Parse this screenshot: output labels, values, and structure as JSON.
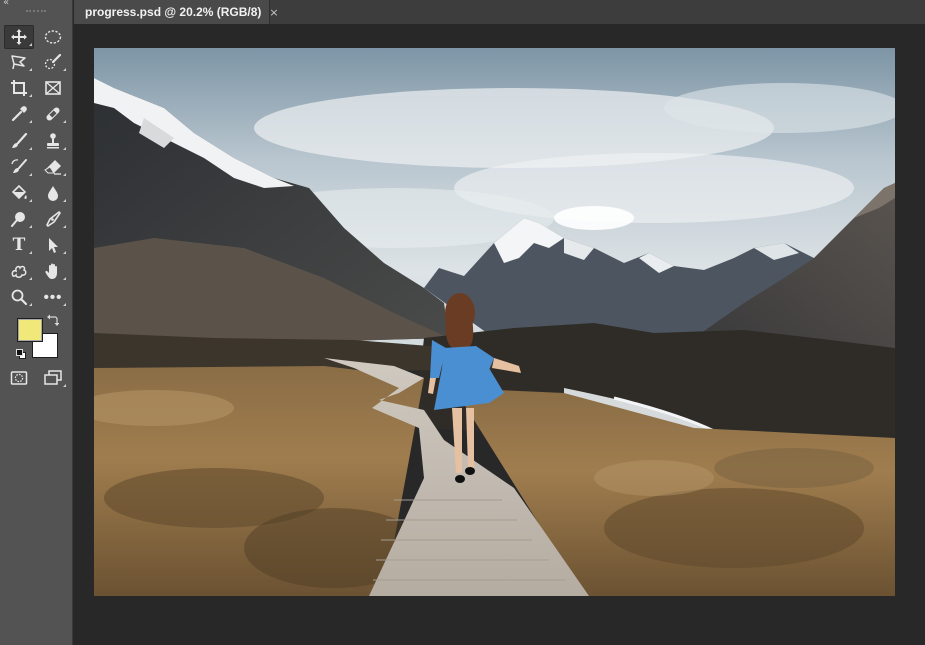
{
  "document": {
    "tab_title": "progress.psd @ 20.2% (RGB/8)",
    "close_glyph": "×"
  },
  "toolbar": {
    "collapse_glyph": "«",
    "type_tool_glyph": "T",
    "more_tools_glyph": "•••",
    "foreground_color": "#f0e878",
    "background_color": "#ffffff",
    "tools": [
      "move-tool",
      "elliptical-marquee-tool",
      "polygonal-lasso-tool",
      "quick-selection-tool",
      "crop-tool",
      "frame-tool",
      "eyedropper-tool",
      "spot-healing-brush-tool",
      "brush-tool",
      "clone-stamp-tool",
      "history-brush-tool",
      "eraser-tool",
      "paint-bucket-tool",
      "blur-tool",
      "dodge-tool",
      "pen-tool",
      "type-tool",
      "path-selection-tool",
      "custom-shape-tool",
      "hand-tool",
      "zoom-tool",
      "edit-toolbar",
      "quick-mask-mode",
      "screen-mode"
    ]
  }
}
